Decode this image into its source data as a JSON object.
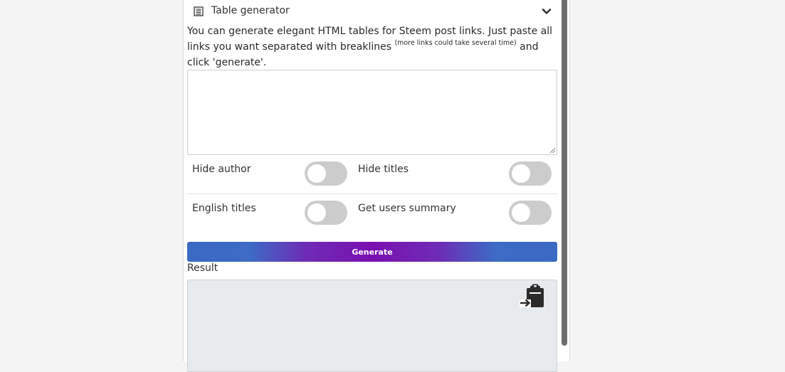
{
  "generator": {
    "title": "Table generator",
    "icon": "table-list-icon",
    "collapse_icon": "chevron-down-icon",
    "description_part1": "You can generate elegant HTML tables for Steem post links. Just paste all links you want separated with breaklines ",
    "description_note": "(more links could take several time)",
    "description_part2": " and click 'generate'.",
    "links_value": "",
    "options": [
      {
        "label": "Hide author",
        "on": false
      },
      {
        "label": "Hide titles",
        "on": false
      },
      {
        "label": "English titles",
        "on": false
      },
      {
        "label": "Get users summary",
        "on": false
      }
    ],
    "generate_label": "Generate",
    "result_label": "Result",
    "result_value": "",
    "copy_icon": "clipboard-paste-icon"
  },
  "colors": {
    "toggle_off": "#cccccc",
    "button_gradient_edge": "#3b6ac4",
    "button_gradient_center": "#7a0fb0",
    "result_bg": "#e8ebee",
    "scrollbar": "#6e6e6e"
  }
}
